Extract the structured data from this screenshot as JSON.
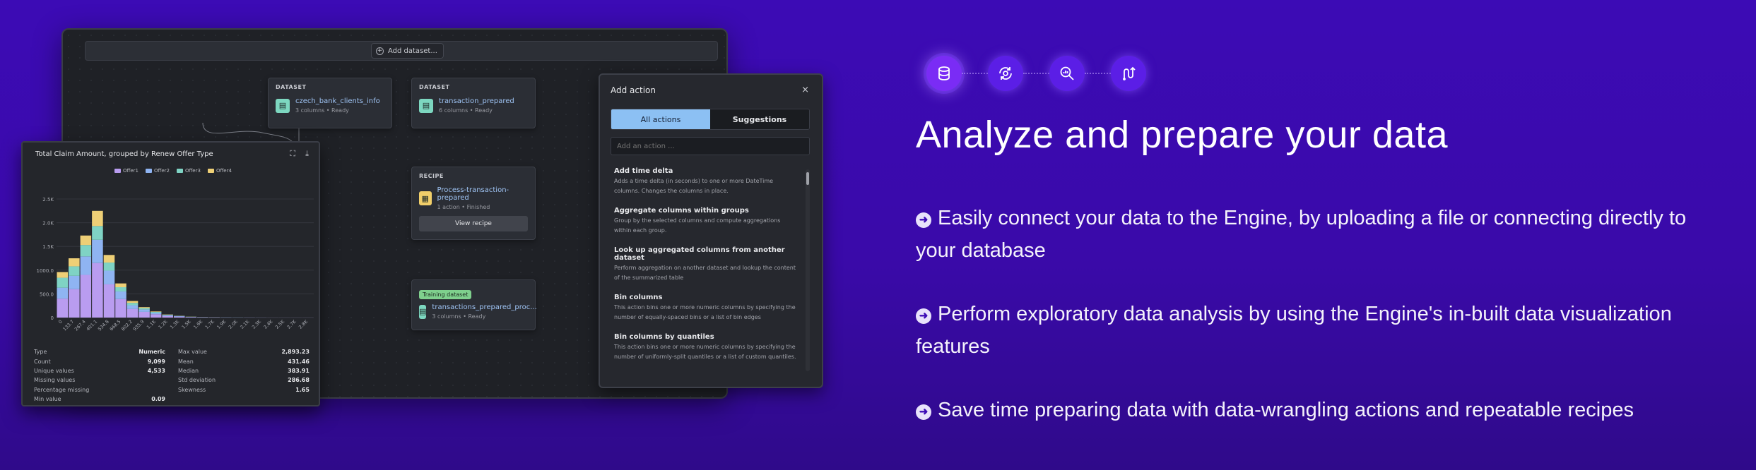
{
  "colors": {
    "background": "#3c0bb5",
    "accent_blue": "#8cc0f3",
    "teal": "#7dd7c0",
    "yellow": "#f1cf6a",
    "green_badge": "#7fd08d"
  },
  "app": {
    "add_dataset_label": "Add dataset...",
    "nodes": {
      "dataset1": {
        "tag": "DATASET",
        "title": "czech_bank_clients_info",
        "meta": "3 columns  •  Ready"
      },
      "dataset2": {
        "tag": "DATASET",
        "title": "transaction_prepared",
        "meta": "6 columns  •  Ready"
      },
      "recipe": {
        "tag": "RECIPE",
        "title": "Process-transaction-prepared",
        "meta": "1 action  •  Finished",
        "button": "View recipe"
      },
      "training": {
        "badge": "Training dataset",
        "title": "transactions_prepared_proc...",
        "meta": "3 columns  •  Ready"
      }
    }
  },
  "add_action": {
    "title": "Add action",
    "close": "×",
    "tabs": [
      "All actions",
      "Suggestions"
    ],
    "search_placeholder": "Add an action ...",
    "actions": [
      {
        "title": "Add time delta",
        "desc": "Adds a time delta (in seconds) to one or more DateTime columns. Changes the columns in place."
      },
      {
        "title": "Aggregate columns within groups",
        "desc": "Group by the selected columns and compute aggregations within each group."
      },
      {
        "title": "Look up aggregated columns from another dataset",
        "desc": "Perform aggregation on another dataset and lookup the content of the summarized table"
      },
      {
        "title": "Bin columns",
        "desc": "This action bins one or more numeric columns by specifying the number of equally-spaced bins or a list of bin edges"
      },
      {
        "title": "Bin columns by quantiles",
        "desc": "This action bins one or more numeric columns by specifying the number of uniformly-split quantiles or a list of custom quantiles."
      }
    ]
  },
  "chart_panel": {
    "title": "Total Claim Amount, grouped by Renew Offer Type",
    "stats_left": [
      {
        "label": "Type",
        "value": "Numeric"
      },
      {
        "label": "Count",
        "value": "9,099"
      },
      {
        "label": "Unique values",
        "value": "4,533"
      },
      {
        "label": "Missing values",
        "value": ""
      },
      {
        "label": "Percentage missing",
        "value": ""
      },
      {
        "label": "Min value",
        "value": "0.09"
      }
    ],
    "stats_right": [
      {
        "label": "Max value",
        "value": "2,893.23"
      },
      {
        "label": "Mean",
        "value": "431.46"
      },
      {
        "label": "Median",
        "value": "383.91"
      },
      {
        "label": "Std deviation",
        "value": "286.68"
      },
      {
        "label": "Skewness",
        "value": "1.65"
      }
    ]
  },
  "chart_data": {
    "type": "bar",
    "stacked": true,
    "title": "Total Claim Amount, grouped by Renew Offer Type",
    "categories": [
      "0",
      "133.7",
      "267.4",
      "401.1",
      "534.8",
      "668.5",
      "802.2",
      "935.9",
      "1.1K",
      "1.2K",
      "1.3K",
      "1.5K",
      "1.6K",
      "1.7K",
      "1.9K",
      "2.0K",
      "2.1K",
      "2.3K",
      "2.4K",
      "2.5K",
      "2.7K",
      "2.8K"
    ],
    "series": [
      {
        "name": "Offer1",
        "color": "#b99cf0",
        "values": [
          400,
          600,
          900,
          1150,
          700,
          390,
          180,
          120,
          70,
          35,
          20,
          10,
          6,
          5,
          3,
          2,
          2,
          1,
          1,
          1,
          1,
          1
        ]
      },
      {
        "name": "Offer2",
        "color": "#8fb4f2",
        "values": [
          230,
          280,
          390,
          490,
          290,
          160,
          80,
          50,
          30,
          15,
          10,
          5,
          3,
          2,
          2,
          1,
          1,
          1,
          0,
          0,
          0,
          0
        ]
      },
      {
        "name": "Offer3",
        "color": "#7fd3c4",
        "values": [
          210,
          200,
          240,
          290,
          170,
          90,
          50,
          30,
          20,
          10,
          5,
          3,
          2,
          1,
          1,
          1,
          0,
          0,
          0,
          0,
          0,
          0
        ]
      },
      {
        "name": "Offer4",
        "color": "#eecf76",
        "values": [
          120,
          170,
          200,
          320,
          160,
          80,
          40,
          20,
          10,
          5,
          3,
          2,
          1,
          1,
          0,
          0,
          0,
          0,
          0,
          0,
          0,
          0
        ]
      }
    ],
    "y_ticks": [
      "0",
      "500.0",
      "1000.0",
      "1.5K",
      "2.0K",
      "2.5K"
    ],
    "ylim": [
      0,
      2500
    ]
  },
  "hero": {
    "feature_icons": [
      "database-icon",
      "brain-cycle-icon",
      "magnifier-chart-icon",
      "pipeline-icon"
    ],
    "title": "Analyze and prepare your data",
    "bullets": [
      "Easily connect your data to the Engine, by uploading a file or connecting directly to your database",
      "Perform exploratory data analysis by using the Engine's in-built data visualization features",
      "Save time preparing data with data-wrangling actions and repeatable recipes"
    ]
  }
}
